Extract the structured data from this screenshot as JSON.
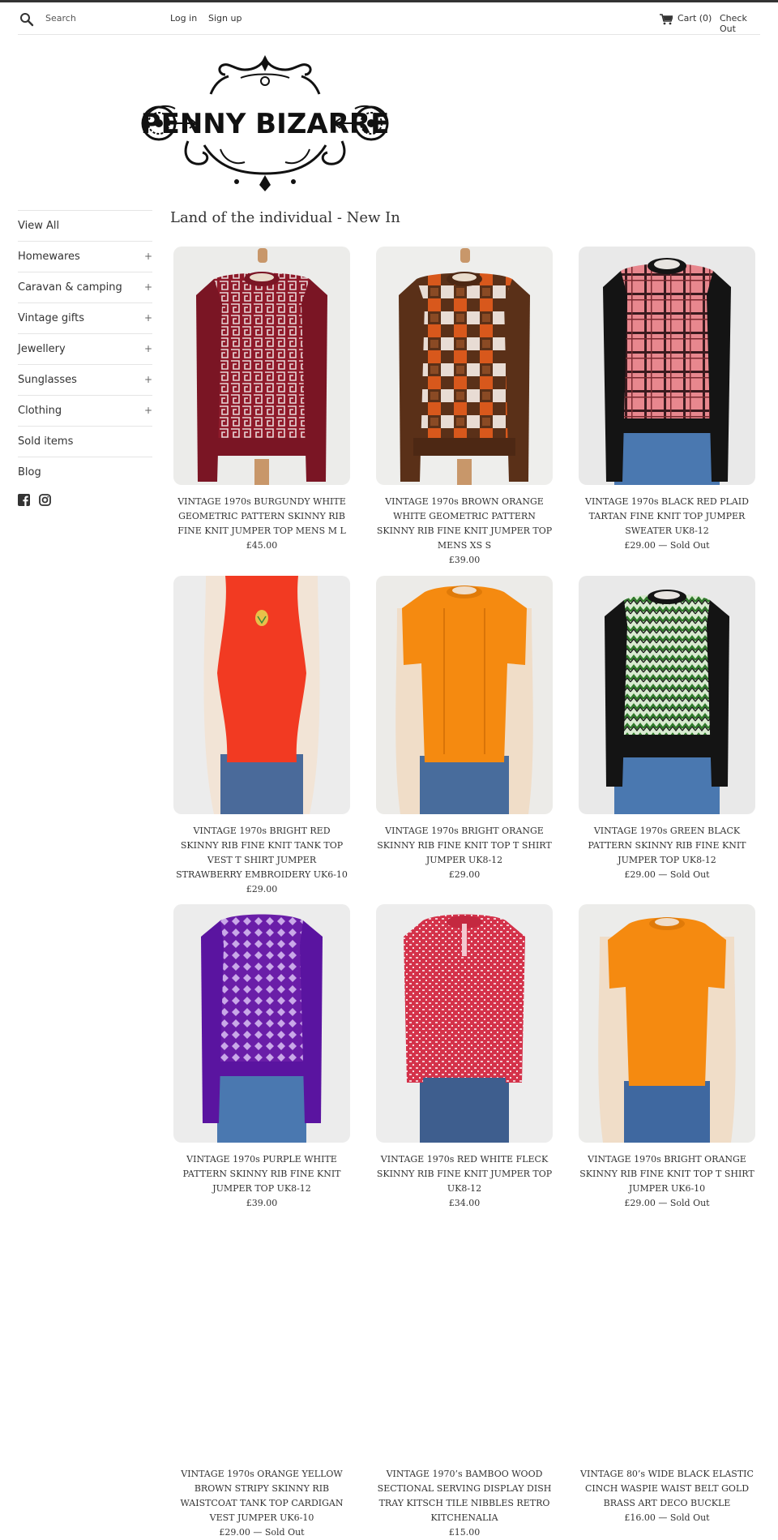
{
  "header": {
    "search_placeholder": "Search",
    "login": "Log in",
    "signup": "Sign up",
    "cart": "Cart (0)",
    "checkout": "Check Out"
  },
  "logo": {
    "text": "PENNY BIZARRE"
  },
  "sidebar": {
    "items": [
      {
        "label": "View All",
        "expandable": false
      },
      {
        "label": "Homewares",
        "expandable": true
      },
      {
        "label": "Caravan & camping",
        "expandable": true
      },
      {
        "label": "Vintage gifts",
        "expandable": true
      },
      {
        "label": "Jewellery",
        "expandable": true
      },
      {
        "label": "Sunglasses",
        "expandable": true
      },
      {
        "label": "Clothing",
        "expandable": true
      },
      {
        "label": "Sold items",
        "expandable": false
      },
      {
        "label": "Blog",
        "expandable": false
      }
    ],
    "plus_symbol": "+",
    "social": [
      "facebook-icon",
      "instagram-icon"
    ]
  },
  "collection": {
    "title": "Land of the individual - New In",
    "products": [
      {
        "name": "VINTAGE 1970s BURGUNDY WHITE GEOMETRIC PATTERN SKINNY RIB FINE KNIT JUMPER TOP MENS M L",
        "price": "£45.00"
      },
      {
        "name": "VINTAGE 1970s BROWN ORANGE WHITE GEOMETRIC PATTERN SKINNY RIB FINE KNIT JUMPER TOP MENS XS S",
        "price": "£39.00"
      },
      {
        "name": "VINTAGE 1970s BLACK RED PLAID TARTAN FINE KNIT TOP JUMPER SWEATER UK8-12",
        "price": "£29.00 — Sold Out"
      },
      {
        "name": "VINTAGE 1970s BRIGHT RED SKINNY RIB FINE KNIT TANK TOP VEST T SHIRT JUMPER STRAWBERRY EMBROIDERY UK6-10",
        "price": "£29.00"
      },
      {
        "name": "VINTAGE 1970s BRIGHT ORANGE SKINNY RIB FINE KNIT TOP T SHIRT JUMPER UK8-12",
        "price": "£29.00"
      },
      {
        "name": "VINTAGE 1970s GREEN BLACK PATTERN SKINNY RIB FINE KNIT JUMPER TOP UK8-12",
        "price": "£29.00 — Sold Out"
      },
      {
        "name": "VINTAGE 1970s PURPLE WHITE PATTERN SKINNY RIB FINE KNIT JUMPER TOP UK8-12",
        "price": "£39.00"
      },
      {
        "name": "VINTAGE 1970s RED WHITE FLECK SKINNY RIB FINE KNIT JUMPER TOP UK8-12",
        "price": "£34.00"
      },
      {
        "name": "VINTAGE 1970s BRIGHT ORANGE SKINNY RIB FINE KNIT TOP T SHIRT JUMPER UK6-10",
        "price": "£29.00 — Sold Out"
      },
      {
        "name": "VINTAGE 1970s ORANGE YELLOW BROWN STRIPY SKINNY RIB WAISTCOAT TANK TOP CARDIGAN VEST JUMPER UK6-10",
        "price": "£29.00 — Sold Out"
      },
      {
        "name": "VINTAGE 1970’s BAMBOO WOOD SECTIONAL SERVING DISPLAY DISH TRAY KITSCH TILE NIBBLES RETRO KITCHENALIA",
        "price": "£15.00"
      },
      {
        "name": "VINTAGE 80’s WIDE BLACK ELASTIC CINCH WASPIE WAIST BELT GOLD BRASS ART DECO BUCKLE",
        "price": "£16.00 — Sold Out"
      }
    ]
  }
}
